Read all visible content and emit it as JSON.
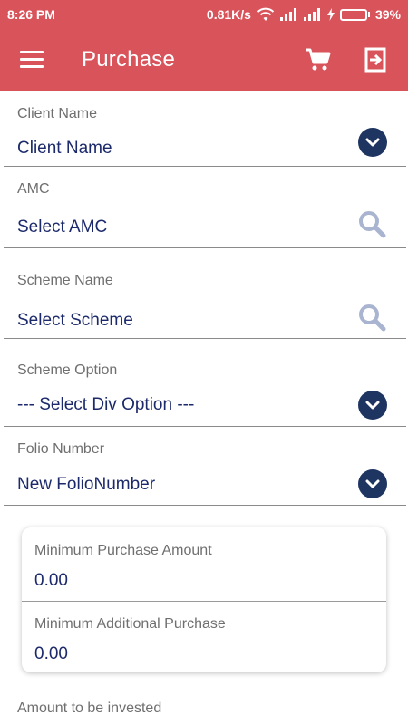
{
  "status_bar": {
    "time": "8:26 PM",
    "network_speed": "0.81K/s",
    "battery_percent": "39%",
    "battery_level": 0.39
  },
  "app_bar": {
    "title": "Purchase",
    "cart_icon": "cart-icon",
    "logout_icon": "logout-icon",
    "menu_icon": "hamburger-menu-icon"
  },
  "form": {
    "client_name": {
      "label": "Client Name",
      "value": "Client Name"
    },
    "amc": {
      "label": "AMC",
      "value": "Select AMC"
    },
    "scheme_name": {
      "label": "Scheme Name",
      "value": "Select Scheme"
    },
    "scheme_option": {
      "label": "Scheme Option",
      "value": "--- Select Div Option ---"
    },
    "folio_number": {
      "label": "Folio Number",
      "value": "New FolioNumber"
    }
  },
  "purchase_card": {
    "min_purchase": {
      "label": "Minimum Purchase Amount",
      "value": "0.00"
    },
    "min_additional": {
      "label": "Minimum Additional Purchase",
      "value": "0.00"
    }
  },
  "amount": {
    "label": "Amount to be invested"
  },
  "colors": {
    "brand": "#d9535a",
    "text_value": "#1c2a6b",
    "dropdown": "#1f3561",
    "search_icon": "#a9b5d0"
  }
}
